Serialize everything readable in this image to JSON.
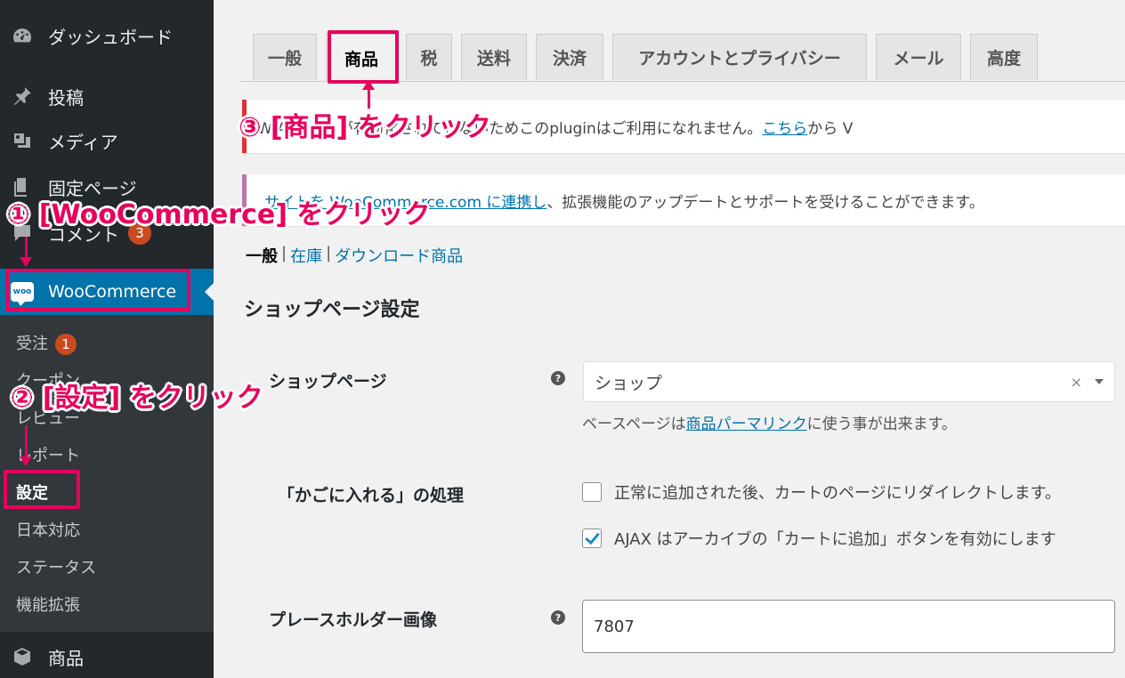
{
  "sidebar": {
    "items": [
      {
        "label": "ダッシュボード",
        "icon": "dashboard-icon"
      },
      {
        "label": "投稿",
        "icon": "pin-icon"
      },
      {
        "label": "メディア",
        "icon": "media-icon"
      },
      {
        "label": "固定ページ",
        "icon": "page-icon"
      },
      {
        "label": "コメント",
        "icon": "comment-icon",
        "badge": "3"
      }
    ],
    "woocommerce": {
      "label": "WooCommerce",
      "logo_text": "woo"
    },
    "submenu": [
      {
        "label": "受注",
        "badge": "1"
      },
      {
        "label": "クーポン"
      },
      {
        "label": "レビュー"
      },
      {
        "label": "レポート"
      },
      {
        "label": "設定"
      },
      {
        "label": "日本対応"
      },
      {
        "label": "ステータス"
      },
      {
        "label": "機能拡張"
      }
    ],
    "products": {
      "label": "商品",
      "icon": "box-icon"
    }
  },
  "tabs": [
    "一般",
    "商品",
    "税",
    "送料",
    "決済",
    "アカウントとプライバシー",
    "メール",
    "高度"
  ],
  "active_tab": "商品",
  "notices": {
    "error": {
      "text": "W API Key が有効化されていないためこのpluginはご利用になれません。",
      "link": "こちら",
      "suffix": "から V"
    },
    "info": {
      "link_pre": "サイトを WooCommerce.com に連携し",
      "text": "、拡張機能のアップデートとサポートを受けることができます。"
    }
  },
  "subnav": {
    "current": "一般",
    "links": [
      "在庫",
      "ダウンロード商品"
    ],
    "sep": "|"
  },
  "section_title": "ショップページ設定",
  "fields": {
    "shop_page": {
      "label": "ショップページ",
      "value": "ショップ",
      "clear": "×",
      "desc_pre": "ベースページは",
      "desc_link": "商品パーマリンク",
      "desc_post": "に使う事が出来ます。"
    },
    "cart": {
      "label": "「かごに入れる」の処理",
      "opt1": "正常に追加された後、カートのページにリダイレクトします。",
      "opt2": "AJAX はアーカイブの「カートに追加」ボタンを有効にします"
    },
    "placeholder": {
      "label": "プレースホルダー画像",
      "value": "7807"
    },
    "help": "?"
  },
  "annotations": {
    "step1": "① [WooCommerce] をクリック",
    "step2": "② [設定] をクリック",
    "step3": "③ [商品] をクリック"
  },
  "colors": {
    "sidebar_bg": "#23282d",
    "submenu_bg": "#32373c",
    "active_blue": "#0073aa",
    "highlight": "#e6005c",
    "badge": "#ca4a1f"
  }
}
